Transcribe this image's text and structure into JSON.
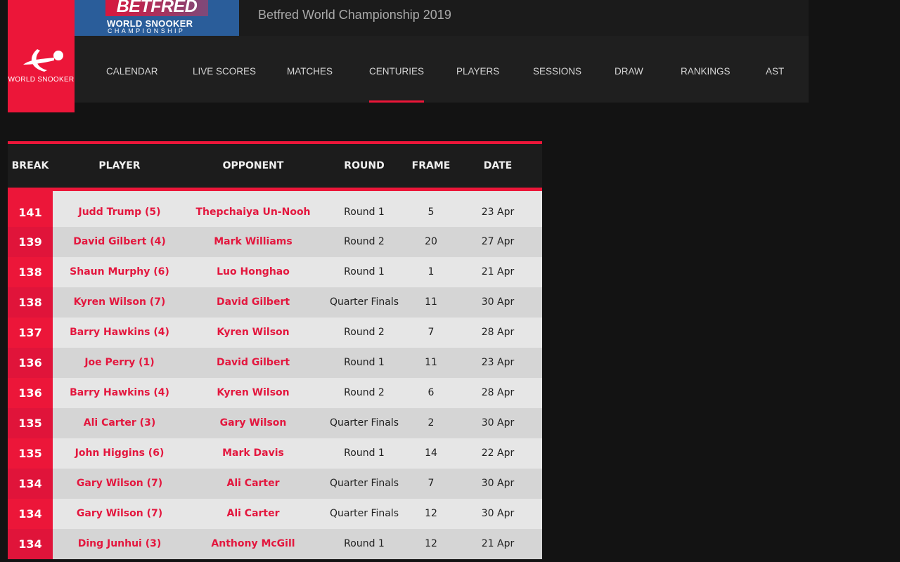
{
  "brand": {
    "logo_text": "WORLD SNOOKER",
    "banner_line1": "BETFRED",
    "banner_line2": "WORLD SNOOKER",
    "banner_line3": "CHAMPIONSHIP",
    "accent": "#ec1639"
  },
  "header": {
    "title": "Betfred World Championship 2019"
  },
  "nav": {
    "active": "CENTURIES",
    "items": [
      "CALENDAR",
      "LIVE SCORES",
      "MATCHES",
      "CENTURIES",
      "PLAYERS",
      "SESSIONS",
      "DRAW",
      "RANKINGS",
      "AST"
    ]
  },
  "table": {
    "columns": [
      "BREAK",
      "PLAYER",
      "OPPONENT",
      "ROUND",
      "FRAME",
      "DATE"
    ],
    "rows": [
      [
        "141",
        "Judd Trump (5)",
        "Thepchaiya Un-Nooh",
        "Round 1",
        "5",
        "23 Apr"
      ],
      [
        "139",
        "David Gilbert (4)",
        "Mark Williams",
        "Round 2",
        "20",
        "27 Apr"
      ],
      [
        "138",
        "Shaun Murphy (6)",
        "Luo Honghao",
        "Round 1",
        "1",
        "21 Apr"
      ],
      [
        "138",
        "Kyren Wilson (7)",
        "David Gilbert",
        "Quarter Finals",
        "11",
        "30 Apr"
      ],
      [
        "137",
        "Barry Hawkins (4)",
        "Kyren Wilson",
        "Round 2",
        "7",
        "28 Apr"
      ],
      [
        "136",
        "Joe Perry (1)",
        "David Gilbert",
        "Round 1",
        "11",
        "23 Apr"
      ],
      [
        "136",
        "Barry Hawkins (4)",
        "Kyren Wilson",
        "Round 2",
        "6",
        "28 Apr"
      ],
      [
        "135",
        "Ali Carter (3)",
        "Gary Wilson",
        "Quarter Finals",
        "2",
        "30 Apr"
      ],
      [
        "135",
        "John Higgins (6)",
        "Mark Davis",
        "Round 1",
        "14",
        "22 Apr"
      ],
      [
        "134",
        "Gary Wilson (7)",
        "Ali Carter",
        "Quarter Finals",
        "7",
        "30 Apr"
      ],
      [
        "134",
        "Gary Wilson (7)",
        "Ali Carter",
        "Quarter Finals",
        "12",
        "30 Apr"
      ],
      [
        "134",
        "Ding Junhui (3)",
        "Anthony McGill",
        "Round 1",
        "12",
        "21 Apr"
      ]
    ]
  }
}
